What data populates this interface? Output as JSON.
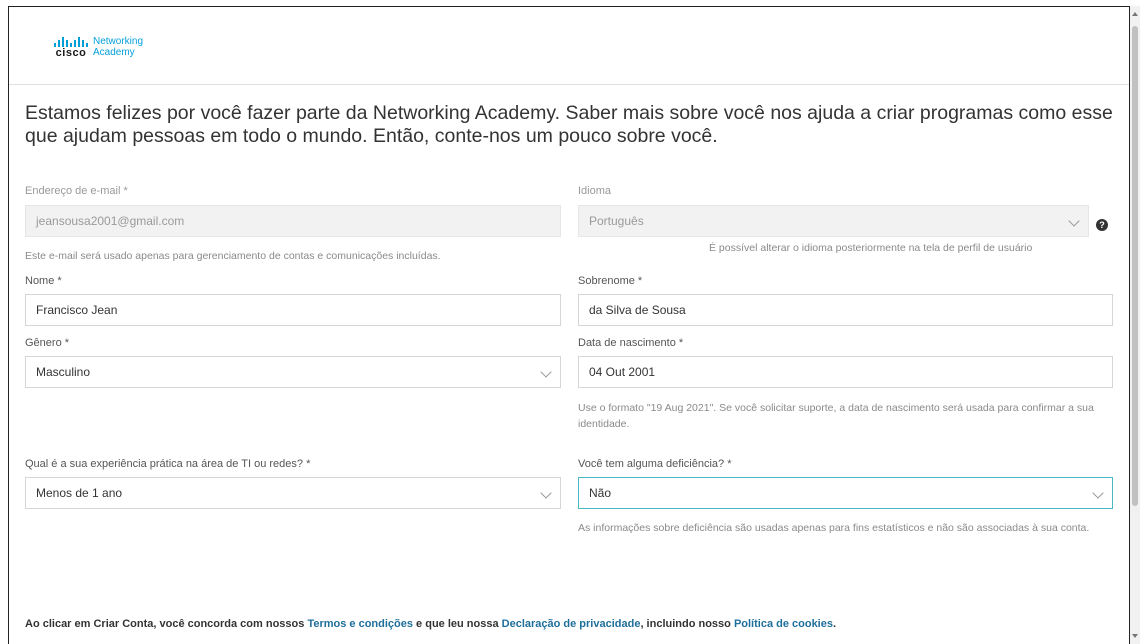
{
  "brand": {
    "logo_word": "cisco",
    "product_line1": "Networking",
    "product_line2": "Academy"
  },
  "intro_text": "Estamos felizes por você fazer parte da Networking Academy. Saber mais sobre você nos ajuda a criar programas como esse que ajudam pessoas em todo o mundo. Então, conte-nos um pouco sobre você.",
  "email": {
    "label": "Endereço de e-mail *",
    "value": "jeansousa2001@gmail.com",
    "hint": "Este e-mail será usado apenas para gerenciamento de contas e comunicações incluídas."
  },
  "language": {
    "label": "Idioma",
    "value": "Português",
    "hint": "É possível alterar o idioma posteriormente na tela de perfil de usuário",
    "help_icon": "?"
  },
  "first_name": {
    "label": "Nome *",
    "value": "Francisco Jean"
  },
  "last_name": {
    "label": "Sobrenome *",
    "value": "da Silva de Sousa"
  },
  "gender": {
    "label": "Gênero *",
    "value": "Masculino"
  },
  "birth_date": {
    "label": "Data de nascimento *",
    "value": "04 Out 2001",
    "hint": "Use o formato \"19 Aug 2021\". Se você solicitar suporte, a data de nascimento será usada para confirmar a sua identidade."
  },
  "experience": {
    "label": "Qual é a sua experiência prática na área de TI ou redes? *",
    "value": "Menos de 1 ano"
  },
  "disability": {
    "label": "Você tem alguma deficiência? *",
    "value": "Não",
    "hint": "As informações sobre deficiência são usadas apenas para fins estatísticos e não são associadas à sua conta."
  },
  "terms": {
    "prefix": "Ao clicar em Criar Conta, você concorda com nossos ",
    "terms_link": "Termos e condições",
    "middle": " e que leu nossa ",
    "privacy_link": "Declaração de privacidade",
    "middle2": ", incluindo nosso ",
    "cookies_link": "Política de cookies",
    "suffix": "."
  },
  "colors": {
    "accent": "#049fd9",
    "link": "#1f6f9b",
    "focus": "#47b8c4"
  }
}
